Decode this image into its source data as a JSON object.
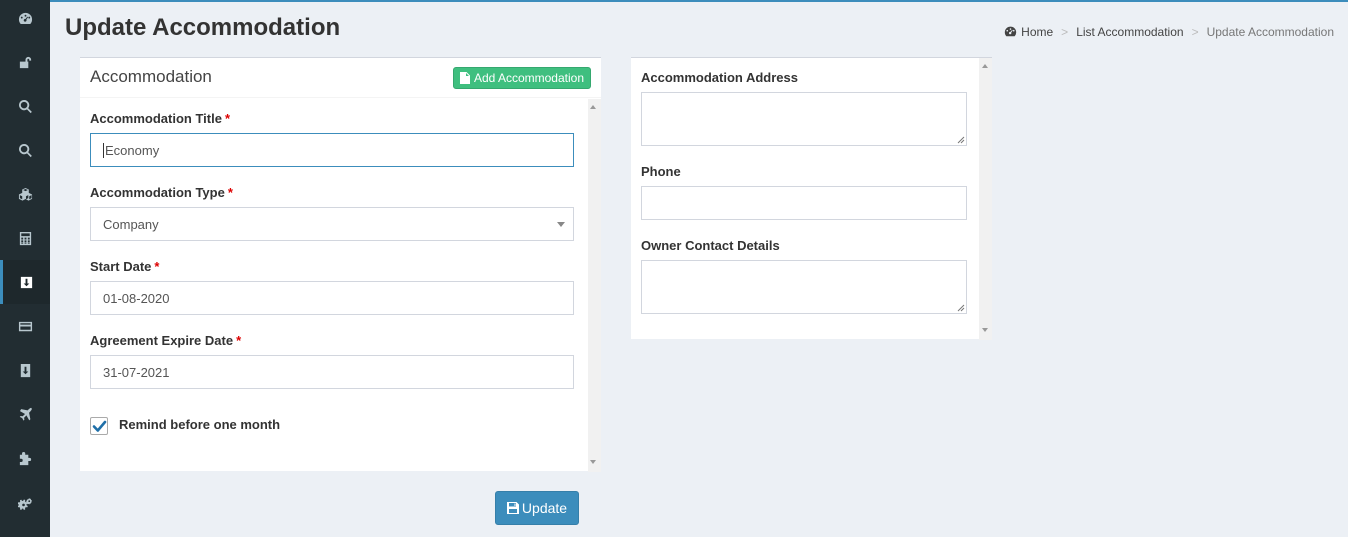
{
  "header": {
    "title": "Update Accommodation",
    "breadcrumb": {
      "home": "Home",
      "list": "List Accommodation",
      "current": "Update Accommodation",
      "separator": ">"
    }
  },
  "sidebar": {
    "items": [
      {
        "icon": "dashboard-icon"
      },
      {
        "icon": "unlock-icon"
      },
      {
        "icon": "search-icon"
      },
      {
        "icon": "search-icon"
      },
      {
        "icon": "cubes-icon"
      },
      {
        "icon": "calculator-icon"
      },
      {
        "icon": "download-icon",
        "active": true
      },
      {
        "icon": "credit-card-icon"
      },
      {
        "icon": "download-icon"
      },
      {
        "icon": "plane-icon"
      },
      {
        "icon": "puzzle-icon"
      },
      {
        "icon": "gears-icon"
      }
    ]
  },
  "form": {
    "box_title": "Accommodation",
    "add_button": "Add Accommodation",
    "title_label": "Accommodation Title",
    "title_value": "Economy",
    "type_label": "Accommodation Type",
    "type_value": "Company",
    "start_label": "Start Date",
    "start_value": "01-08-2020",
    "expire_label": "Agreement Expire Date",
    "expire_value": "31-07-2021",
    "remind_label": "Remind before one month",
    "remind_checked": true,
    "required_mark": "*"
  },
  "details": {
    "address_label": "Accommodation Address",
    "address_value": "",
    "phone_label": "Phone",
    "phone_value": "",
    "owner_label": "Owner Contact Details",
    "owner_value": ""
  },
  "actions": {
    "update_label": "Update"
  },
  "colors": {
    "primary": "#3c8dbc",
    "success": "#3fbf7f",
    "sidebar": "#222d32",
    "required": "#dd0000"
  }
}
